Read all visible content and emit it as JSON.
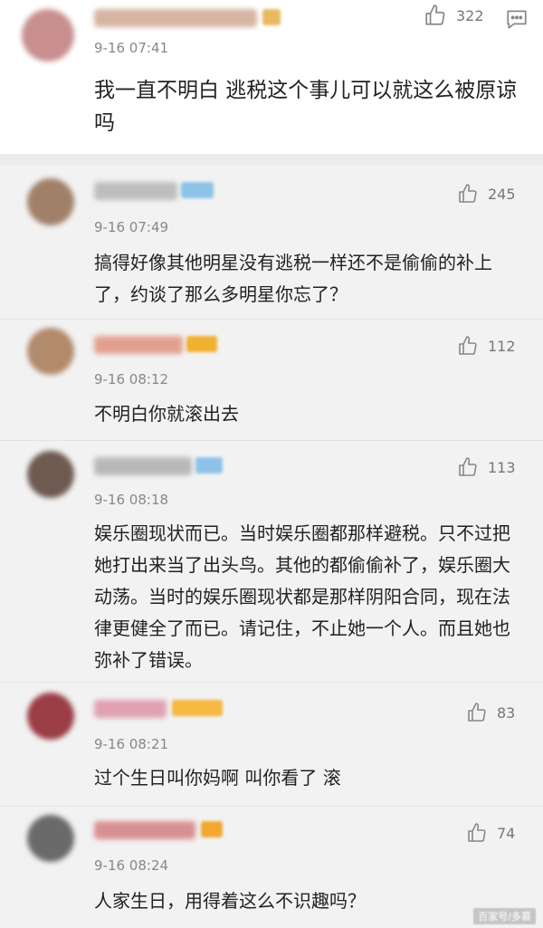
{
  "comments": [
    {
      "time": "9-16 07:41",
      "text": "我一直不明白 逃税这个事儿可以就这么被原谅吗",
      "likes": "322",
      "avatar_color": "#c98f8f",
      "name_color": "#d1b09a",
      "badge_color": "#e8b960"
    },
    {
      "time": "9-16 07:49",
      "text": "搞得好像其他明星没有逃税一样还不是偷偷的补上了，约谈了那么多明星你忘了？",
      "likes": "245",
      "avatar_color": "#a08068",
      "name_color": "#bbbbbb",
      "badge_color": "#8ec3e8"
    },
    {
      "time": "9-16 08:12",
      "text": "不明白你就滚出去",
      "likes": "112",
      "avatar_color": "#b28a6c",
      "name_color": "#e3a090",
      "badge_color": "#f0b030"
    },
    {
      "time": "9-16 08:18",
      "text": "娱乐圈现状而已。当时娱乐圈都那样避税。只不过把她打出来当了出头鸟。其他的都偷偷补了，娱乐圈大动荡。当时的娱乐圈现状都是那样阴阳合同，现在法律更健全了而已。请记住，不止她一个人。而且她也弥补了错误。",
      "likes": "113",
      "avatar_color": "#6e5a50",
      "name_color": "#b8b8b8",
      "badge_color": "#8ec3e8"
    },
    {
      "time": "9-16 08:21",
      "text": "过个生日叫你妈啊 叫你看了 滚",
      "likes": "83",
      "avatar_color": "#9a3d45",
      "name_color": "#e0a0b0",
      "badge_color": "#f5b840"
    },
    {
      "time": "9-16 08:24",
      "text": "人家生日，用得着这么不识趣吗？",
      "likes": "74",
      "avatar_color": "#6a6a6a",
      "name_color": "#d89090",
      "badge_color": "#f0a830"
    }
  ],
  "watermark": "百家号/多慕",
  "icons": {
    "like": "thumbs-up-icon",
    "message": "message-icon"
  }
}
